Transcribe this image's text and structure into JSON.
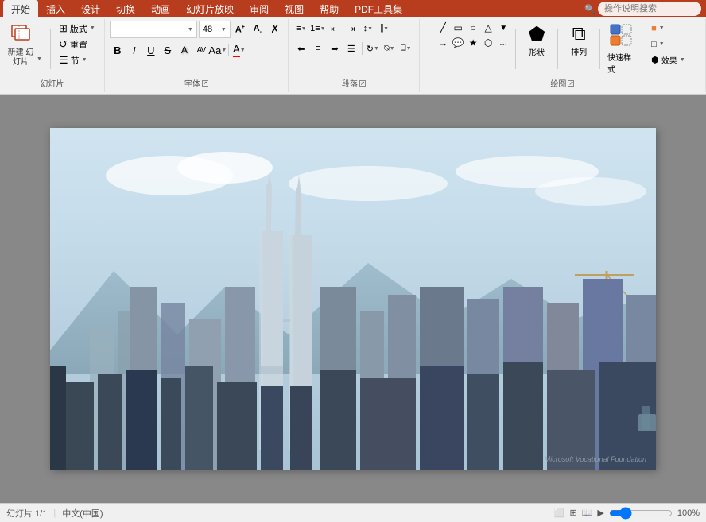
{
  "ribbon": {
    "tabs": [
      "开始",
      "插入",
      "设计",
      "切换",
      "动画",
      "幻灯片放映",
      "审阅",
      "视图",
      "帮助",
      "PDF工具集",
      "操作说明搜索"
    ],
    "active_tab": "开始",
    "search_placeholder": "操作说明搜索"
  },
  "sections": {
    "slides": {
      "label": "幻灯片",
      "new_slide": "新建\n幻灯片",
      "layout": "版式",
      "reset": "重置",
      "section": "节"
    },
    "font": {
      "label": "字体",
      "font_name": "",
      "font_size": "48",
      "bold": "B",
      "italic": "I",
      "underline": "U",
      "strikethrough": "S",
      "shadow": "A",
      "increase_font": "A↑",
      "decrease_font": "A↓",
      "clear": "✗",
      "char_spacing": "AV",
      "change_case": "Aa",
      "font_color": "A"
    },
    "paragraph": {
      "label": "段落"
    },
    "drawing": {
      "label": "绘图",
      "shape_label": "形状",
      "arrange_label": "排列",
      "quick_style_label": "快速样式"
    }
  },
  "slide": {
    "watermark": "Microsoft Vocational Foundation"
  },
  "status": {
    "slide_count": "幻灯片 1/1",
    "language": "中文(中国)"
  }
}
